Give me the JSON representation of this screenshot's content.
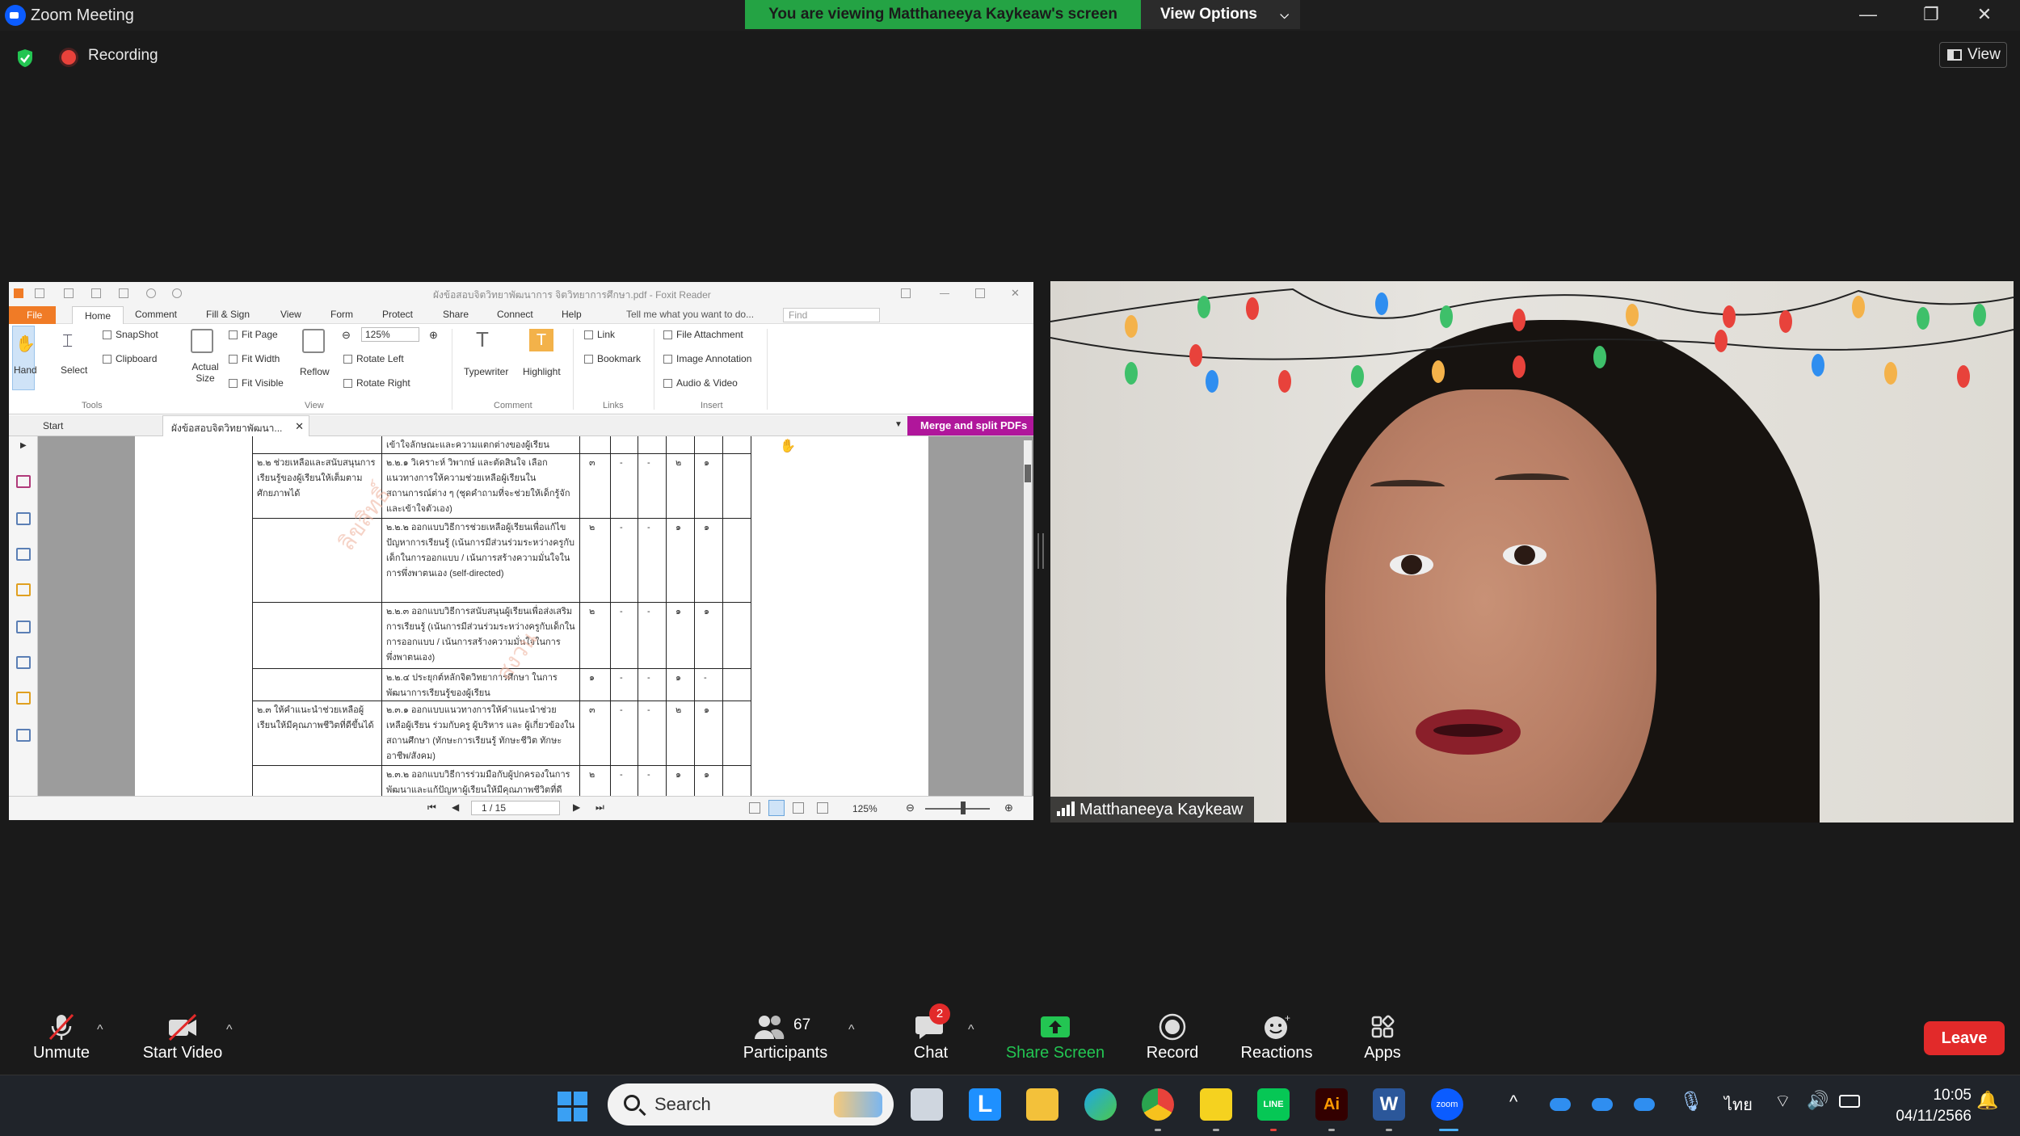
{
  "window": {
    "title": "Zoom Meeting",
    "banner_text": "You are viewing Matthaneeya Kaykeaw's screen",
    "view_options": "View Options",
    "controls": {
      "minimize": "—",
      "restore": "❐",
      "close": "✕"
    }
  },
  "meeting": {
    "recording_label": "Recording",
    "view_label": "View"
  },
  "shared_app": {
    "title": "ผังข้อสอบจิตวิทยาพัฒนาการ  จิตวิทยาการศึกษา.pdf - Foxit Reader",
    "tabs": [
      "File",
      "Home",
      "Comment",
      "Fill & Sign",
      "View",
      "Form",
      "Protect",
      "Share",
      "Connect",
      "Help"
    ],
    "tell_me": "Tell me what you want to do...",
    "find_placeholder": "Find",
    "ribbon": {
      "hand": "Hand",
      "select": "Select",
      "snapshot": "SnapShot",
      "clipboard": "Clipboard",
      "actual_size": "Actual Size",
      "fit_page": "Fit Page",
      "fit_width": "Fit Width",
      "fit_visible": "Fit Visible",
      "reflow": "Reflow",
      "zoom_value": "125%",
      "rotate_left": "Rotate Left",
      "rotate_right": "Rotate Right",
      "typewriter": "Typewriter",
      "highlight": "Highlight",
      "link": "Link",
      "bookmark": "Bookmark",
      "file_attachment": "File Attachment",
      "image_annotation": "Image Annotation",
      "audio_video": "Audio & Video",
      "groups": [
        "Tools",
        "View",
        "Comment",
        "Links",
        "Insert"
      ]
    },
    "doc_tabs": {
      "start": "Start",
      "current": "ผังข้อสอบจิตวิทยาพัฒนา..."
    },
    "merge_button": "Merge and split PDFs",
    "status": {
      "page": "1 / 15",
      "zoom": "125%"
    },
    "document_rows": [
      {
        "col1": "",
        "col2": "เข้าใจลักษณะและความแตกต่างของผู้เรียน",
        "vals": [
          "",
          "",
          "",
          "",
          ""
        ]
      },
      {
        "col1": "๒.๒ ช่วยเหลือและสนับสนุนการเรียนรู้ของผู้เรียนให้เต็มตามศักยภาพได้",
        "col2": "๒.๒.๑ วิเคราะห์ วิพากษ์ และตัดสินใจ เลือกแนวทางการให้ความช่วยเหลือผู้เรียนในสถานการณ์ต่าง ๆ (ชุดคำถามที่จะช่วยให้เด็กรู้จัก และเข้าใจตัวเอง)",
        "vals": [
          "๓",
          "-",
          "-",
          "๒",
          "๑"
        ]
      },
      {
        "col1": "",
        "col2": "๒.๒.๒ ออกแบบวิธีการช่วยเหลือผู้เรียนเพื่อแก้ไขปัญหาการเรียนรู้ (เน้นการมีส่วนร่วมระหว่างครูกับเด็กในการออกแบบ / เน้นการสร้างความมั่นใจในการพึ่งพาตนเอง (self-directed)",
        "vals": [
          "๒",
          "-",
          "-",
          "๑",
          "๑"
        ]
      },
      {
        "col1": "",
        "col2": "๒.๒.๓ ออกแบบวิธีการสนับสนุนผู้เรียนเพื่อส่งเสริมการเรียนรู้ (เน้นการมีส่วนร่วมระหว่างครูกับเด็กในการออกแบบ / เน้นการสร้างความมั่นใจในการพึ่งพาตนเอง)",
        "vals": [
          "๒",
          "-",
          "-",
          "๑",
          "๑"
        ]
      },
      {
        "col1": "",
        "col2": "๒.๒.๔ ประยุกต์หลักจิตวิทยาการศึกษา ในการพัฒนาการเรียนรู้ของผู้เรียน",
        "vals": [
          "๑",
          "-",
          "-",
          "๑",
          "-"
        ]
      },
      {
        "col1": "๒.๓ ให้คำแนะนำช่วยเหลือผู้เรียนให้มีคุณภาพชีวิตที่ดีขึ้นได้",
        "col2": "๒.๓.๑ ออกแบบแนวทางการให้คำแนะนำช่วยเหลือผู้เรียน ร่วมกับครู ผู้บริหาร และ ผู้เกี่ยวข้องในสถานศึกษา (ทักษะการเรียนรู้ ทักษะชีวิต ทักษะอาชีพ/สังคม)",
        "vals": [
          "๓",
          "-",
          "-",
          "๒",
          "๑"
        ]
      },
      {
        "col1": "",
        "col2": "๒.๓.๒ ออกแบบวิธีการร่วมมือกับผู้ปกครองในการพัฒนาและแก้ปัญหาผู้เรียนให้มีคุณภาพชีวิตที่ดี",
        "vals": [
          "๒",
          "-",
          "-",
          "๑",
          "๑"
        ]
      }
    ]
  },
  "video": {
    "participant_name": "Matthaneeya Kaykeaw"
  },
  "toolbar": {
    "unmute": "Unmute",
    "start_video": "Start Video",
    "participants": "Participants",
    "participant_count": "67",
    "chat": "Chat",
    "chat_badge": "2",
    "share_screen": "Share Screen",
    "record": "Record",
    "reactions": "Reactions",
    "apps": "Apps",
    "leave": "Leave",
    "colors": {
      "share_green": "#23c552",
      "leave_red": "#e22a2a",
      "accent_blue": "#0b5cff"
    }
  },
  "taskbar": {
    "search": "Search",
    "language": "ไทย",
    "time": "10:05",
    "date": "04/11/2566"
  }
}
